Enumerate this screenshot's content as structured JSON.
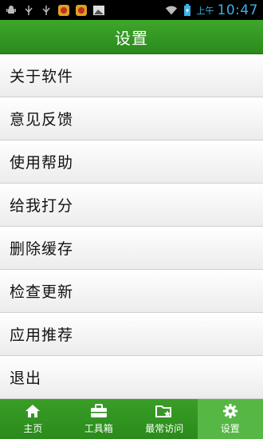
{
  "status_bar": {
    "ampm": "上午",
    "time": "10:47",
    "icons": [
      "android-icon",
      "usb-icon",
      "usb-icon",
      "security-app-icon",
      "security-app-icon",
      "image-icon",
      "wifi-icon",
      "battery-charging-icon"
    ]
  },
  "header": {
    "title": "设置"
  },
  "menu": {
    "items": [
      {
        "label": "关于软件"
      },
      {
        "label": "意见反馈"
      },
      {
        "label": "使用帮助"
      },
      {
        "label": "给我打分"
      },
      {
        "label": "删除缓存"
      },
      {
        "label": "检查更新"
      },
      {
        "label": "应用推荐"
      },
      {
        "label": "退出"
      }
    ]
  },
  "tabbar": {
    "tabs": [
      {
        "label": "主页",
        "icon": "home-icon"
      },
      {
        "label": "工具箱",
        "icon": "toolbox-icon"
      },
      {
        "label": "最常访问",
        "icon": "star-folder-icon"
      },
      {
        "label": "设置",
        "icon": "gear-icon"
      }
    ],
    "active_index": 3
  },
  "colors": {
    "accent": "#2a8a1b",
    "active_tab": "#56b744",
    "status_text": "#3ab0e6"
  }
}
